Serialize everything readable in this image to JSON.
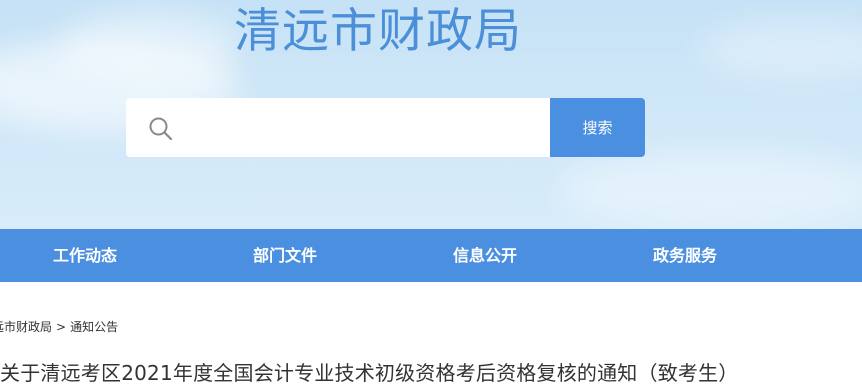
{
  "header": {
    "site_title": "清远市财政局"
  },
  "search": {
    "placeholder": "",
    "value": "",
    "button_label": "搜索"
  },
  "nav": {
    "items": [
      {
        "label": "工作动态"
      },
      {
        "label": "部门文件"
      },
      {
        "label": "信息公开"
      },
      {
        "label": "政务服务"
      }
    ]
  },
  "breadcrumb": {
    "items": [
      "远市财政局",
      "通知公告"
    ],
    "separator": ">"
  },
  "article": {
    "title": "关于清远考区2021年度全国会计专业技术初级资格考后资格复核的通知（致考生）"
  },
  "colors": {
    "accent": "#4b8fe0",
    "title": "#4b8fd8",
    "hero_bg": "#cfe7f8"
  }
}
